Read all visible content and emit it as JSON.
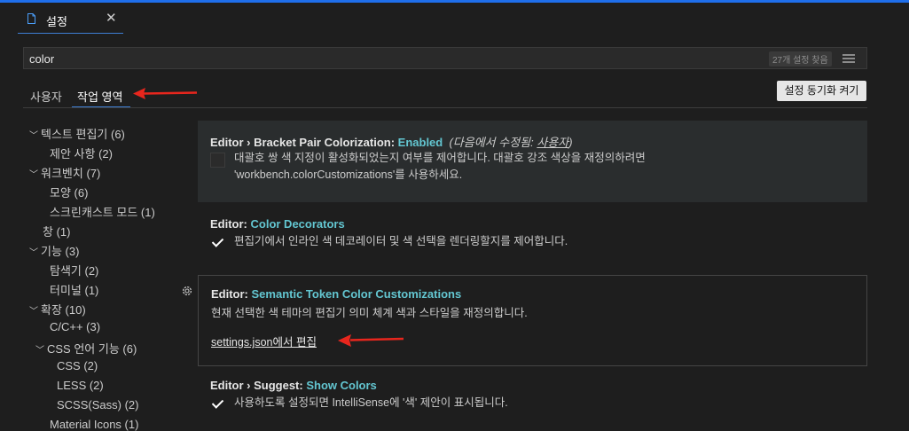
{
  "tab": {
    "label": "설정",
    "close_glyph": "✕",
    "icon": "file-icon"
  },
  "search": {
    "value": "color",
    "count": "27개 설정 찾음",
    "icon": "filter-icon"
  },
  "scopes": {
    "user": "사용자",
    "workspace": "작업 영역"
  },
  "sync_button": "설정 동기화 켜기",
  "toc": [
    {
      "label": "텍스트 편집기 (6)",
      "level": 0,
      "expanded": true
    },
    {
      "label": "제안 사항 (2)",
      "level": 1
    },
    {
      "label": "워크벤치 (7)",
      "level": 0,
      "expanded": true
    },
    {
      "label": "모양 (6)",
      "level": 1
    },
    {
      "label": "스크린캐스트 모드 (1)",
      "level": 1
    },
    {
      "label": "창 (1)",
      "level": 0
    },
    {
      "label": "기능 (3)",
      "level": 0,
      "expanded": true
    },
    {
      "label": "탐색기 (2)",
      "level": 1
    },
    {
      "label": "터미널 (1)",
      "level": 1
    },
    {
      "label": "확장 (10)",
      "level": 0,
      "expanded": true
    },
    {
      "label": "C/C++ (3)",
      "level": 1
    },
    {
      "label": "CSS 언어 기능 (6)",
      "level": 1,
      "expanded": true
    },
    {
      "label": "CSS (2)",
      "level": 2
    },
    {
      "label": "LESS (2)",
      "level": 2
    },
    {
      "label": "SCSS(Sass) (2)",
      "level": 2
    },
    {
      "label": "Material Icons (1)",
      "level": 1
    }
  ],
  "settings": [
    {
      "prefix": "Editor › Bracket Pair Colorization: ",
      "name": "Enabled",
      "modified_prefix": "(다음에서 수정됨: ",
      "modified_link": "사용자",
      "modified_suffix": ")",
      "desc_line1": "대괄호 쌍 색 지정이 활성화되었는지 여부를 제어합니다. 대괄호 강조 색상을 재정의하려면",
      "desc_line2": "'workbench.colorCustomizations'를 사용하세요.",
      "checked": false
    },
    {
      "prefix": "Editor: ",
      "name": "Color Decorators",
      "desc": "편집기에서 인라인 색 데코레이터 및 색 선택을 렌더링할지를 제어합니다.",
      "checked": true
    },
    {
      "prefix": "Editor: ",
      "name": "Semantic Token Color Customizations",
      "desc": "현재 선택한 색 테마의 편집기 의미 체계 색과 스타일을 재정의합니다.",
      "link": "settings.json에서 편집",
      "gear_icon": "gear-icon"
    },
    {
      "prefix": "Editor › Suggest: ",
      "name": "Show Colors",
      "desc": "사용하도록 설정되면 IntelliSense에 '색' 제안이 표시됩니다.",
      "checked": true
    }
  ],
  "colors": {
    "accent": "#63c6d1",
    "arrow": "#e8261d",
    "focus": "#3e7fd4"
  }
}
